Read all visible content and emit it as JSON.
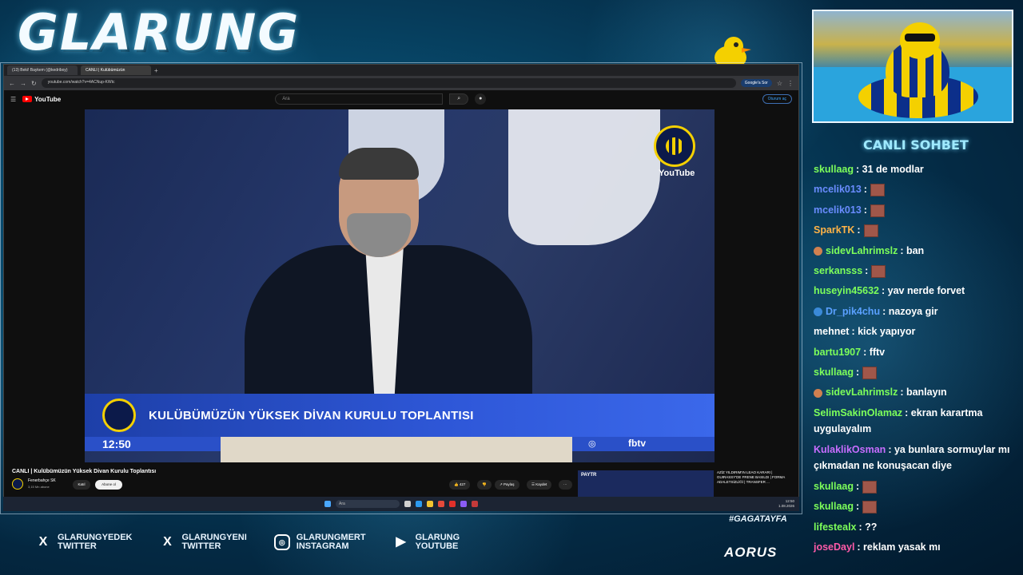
{
  "overlay": {
    "channel_logo": "GLARUNG",
    "hashtag": "#GAGATAYFA",
    "sponsor": "AORUS",
    "chat_title": "CANLI SOHBET",
    "socials": [
      {
        "icon": "x-icon",
        "line1": "GLARUNGYEDEK",
        "line2": "TWITTER"
      },
      {
        "icon": "x-icon",
        "line1": "GLARUNGYENI",
        "line2": "TWITTER"
      },
      {
        "icon": "instagram-icon",
        "line1": "GLARUNGMERT",
        "line2": "INSTAGRAM"
      },
      {
        "icon": "youtube-icon",
        "line1": "GLARUNG",
        "line2": "YOUTUBE"
      }
    ]
  },
  "browser": {
    "tabs": [
      "(13) Beki! Baykem (@kedriboy)",
      "CANLI | Kulübümüzün"
    ],
    "url": "youtube.com/watch?v=4ACNup-KWtc",
    "google_btn": "Google'a Sor"
  },
  "youtube": {
    "logo": "YouTube",
    "search_placeholder": "Ara",
    "signin": "Oturum aç",
    "video": {
      "watermark": "YouTube",
      "lower_third": "KULÜBÜMÜZÜN YÜKSEK DİVAN KURULU TOPLANTISI",
      "time": "12:50",
      "brand": "fbtv"
    },
    "title": "CANLI | Kulübümüzün Yüksek Divan Kurulu Toplantısı",
    "channel": "Fenerbahçe SK",
    "subs": "3,15 Mn abone",
    "join": "Katıl",
    "subscribe": "Abone ol",
    "likes": "427",
    "share": "Paylaş",
    "save": "Kaydet",
    "more": "···",
    "side_card": {
      "label": "PAYTR",
      "text": "AZİZ YILDIRIM'IN LEAO KARARI | GUIRASSY'DE FRENE BASILDI | FORMA ADALETSİZLİĞİ | TRANSFER ..."
    }
  },
  "taskbar": {
    "search": "Ara",
    "time": "12:50",
    "date": "1.08.2026"
  },
  "chat": [
    {
      "user": "skullaag",
      "color": "#7dff5a",
      "text": ": 31 de modlar",
      "emote": false,
      "badge": ""
    },
    {
      "user": "mcelik013",
      "color": "#6a8cff",
      "text": ":",
      "emote": true,
      "badge": ""
    },
    {
      "user": "mcelik013",
      "color": "#6a8cff",
      "text": ":",
      "emote": true,
      "badge": ""
    },
    {
      "user": "SparkTK",
      "color": "#ffb347",
      "text": ":",
      "emote": true,
      "badge": ""
    },
    {
      "user": "sidevLahrimslz",
      "color": "#7dff5a",
      "text": ": ban",
      "emote": false,
      "badge": "#d08050"
    },
    {
      "user": "serkansss",
      "color": "#7dff5a",
      "text": ":",
      "emote": true,
      "badge": ""
    },
    {
      "user": "huseyin45632",
      "color": "#7dff5a",
      "text": ": yav nerde forvet",
      "emote": false,
      "badge": ""
    },
    {
      "user": "Dr_pik4chu",
      "color": "#5aa0ff",
      "text": ": nazoya gir",
      "emote": false,
      "badge": "#3a8ad8"
    },
    {
      "user": "mehnet",
      "color": "#ffffff",
      "text": ": kick yapıyor",
      "emote": false,
      "badge": ""
    },
    {
      "user": "bartu1907",
      "color": "#7dff5a",
      "text": ": fftv",
      "emote": false,
      "badge": ""
    },
    {
      "user": "skullaag",
      "color": "#7dff5a",
      "text": ":",
      "emote": true,
      "badge": ""
    },
    {
      "user": "sidevLahrimslz",
      "color": "#7dff5a",
      "text": ": banlayın",
      "emote": false,
      "badge": "#d08050"
    },
    {
      "user": "SelimSakinOlamaz",
      "color": "#7dff5a",
      "text": ": ekran karartma uygulayalım",
      "emote": false,
      "badge": "",
      "wrap": true
    },
    {
      "user": "KulaklikOsman",
      "color": "#c86dff",
      "text": ": ya bunlara sormuylar mı çıkmadan ne konuşacan diye",
      "emote": false,
      "badge": "",
      "wrap": true
    },
    {
      "user": "skullaag",
      "color": "#7dff5a",
      "text": ":",
      "emote": true,
      "badge": ""
    },
    {
      "user": "skullaag",
      "color": "#7dff5a",
      "text": ":",
      "emote": true,
      "badge": ""
    },
    {
      "user": "lifestealx",
      "color": "#7dff5a",
      "text": ": ??",
      "emote": false,
      "badge": ""
    },
    {
      "user": "joseDayl",
      "color": "#ff5aa8",
      "text": ": reklam yasak mı",
      "emote": false,
      "badge": ""
    }
  ]
}
